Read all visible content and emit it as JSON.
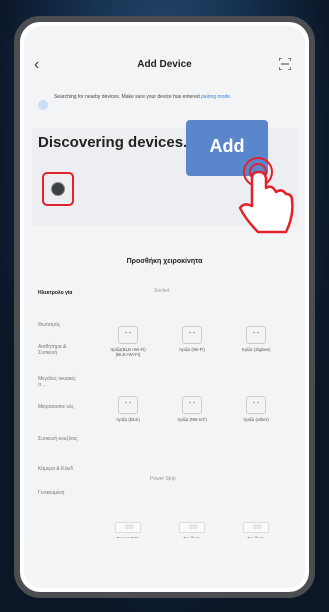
{
  "header": {
    "back_icon": "chevron-left-icon",
    "title": "Add Device",
    "scan_icon": "scan-icon"
  },
  "notice": {
    "text": "Searching for nearby devices. Make sure your device has entered ",
    "link": "pairing mode."
  },
  "discovery": {
    "label": "Discovering devices..."
  },
  "overlay": {
    "add_label": "Add",
    "accent": "#5a86cc",
    "highlight": "#e3212b"
  },
  "manual": {
    "title": "Προσθήκη χειροκίνητα"
  },
  "categories": [
    {
      "label": "Ηλεκτρολο γία",
      "active": true
    },
    {
      "label": "Φωτισμός",
      "active": false
    },
    {
      "label": "Αισθητήρα & Συσκευή",
      "active": false
    },
    {
      "label": "Μεγάλες οικιακές σ...",
      "active": false
    },
    {
      "label": "Μικροσυσκε υές",
      "active": false
    },
    {
      "label": "Συσκευή κουζίνας",
      "active": false
    },
    {
      "label": "Κάμερα & Κλειδ",
      "active": false
    },
    {
      "label": "Γενικευμένη",
      "active": false
    }
  ],
  "sections": {
    "socket": "Socket",
    "power_strip": "Power Strip"
  },
  "devices": [
    {
      "label": "πρίζα(BLE+Wi-Fi) (BLE+Wi-Fi)"
    },
    {
      "label": "πρίζα (Wi-Fi)"
    },
    {
      "label": "πρίζα (Zigbee)"
    },
    {
      "label": "πρίζα (BLE)"
    },
    {
      "label": "πρίζα (NB-IoT)"
    },
    {
      "label": "πρίζα (other)"
    }
  ],
  "strips": [
    {
      "label": "Power Strip"
    },
    {
      "label": "Συνδεση"
    },
    {
      "label": "Συνδεση"
    }
  ]
}
